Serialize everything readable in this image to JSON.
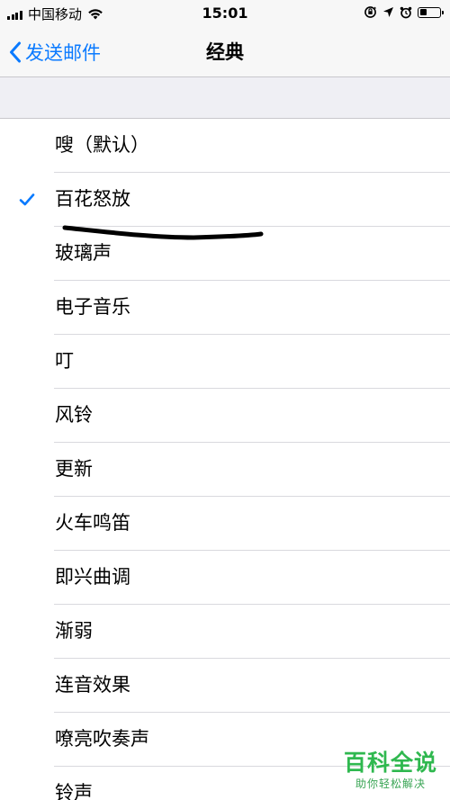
{
  "status_bar": {
    "carrier": "中国移动",
    "time": "15:01",
    "battery_level": 0.35
  },
  "nav": {
    "back_label": "发送邮件",
    "title": "经典"
  },
  "tones": [
    {
      "label": "嗖（默认）",
      "selected": false
    },
    {
      "label": "百花怒放",
      "selected": true
    },
    {
      "label": "玻璃声",
      "selected": false
    },
    {
      "label": "电子音乐",
      "selected": false
    },
    {
      "label": "叮",
      "selected": false
    },
    {
      "label": "风铃",
      "selected": false
    },
    {
      "label": "更新",
      "selected": false
    },
    {
      "label": "火车鸣笛",
      "selected": false
    },
    {
      "label": "即兴曲调",
      "selected": false
    },
    {
      "label": "渐弱",
      "selected": false
    },
    {
      "label": "连音效果",
      "selected": false
    },
    {
      "label": "嘹亮吹奏声",
      "selected": false
    },
    {
      "label": "铃声",
      "selected": false
    }
  ],
  "watermark": {
    "main": "百科全说",
    "sub": "助你轻松解决"
  },
  "colors": {
    "accent": "#0a7aff",
    "watermark": "#2fb84f"
  }
}
